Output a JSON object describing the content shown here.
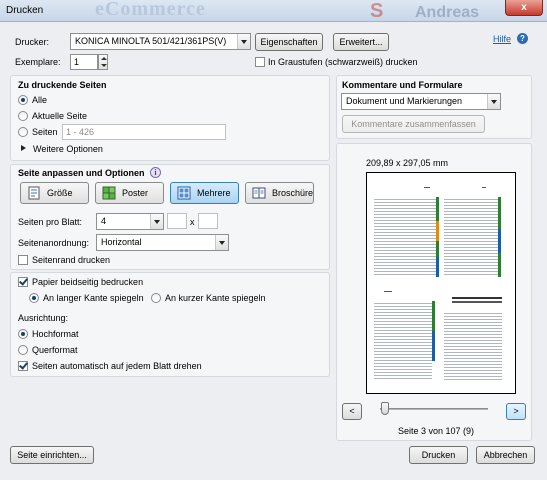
{
  "window": {
    "title": "Drucken",
    "close_label": "x",
    "background_text": [
      "eCommerce",
      "S",
      "Andreas"
    ]
  },
  "printer": {
    "label": "Drucker:",
    "value": "KONICA MINOLTA 501/421/361PS(V)",
    "properties_button": "Eigenschaften",
    "advanced_button": "Erweitert...",
    "help_link": "Hilfe",
    "copies_label": "Exemplare:",
    "copies_value": "1",
    "grayscale_label": "In Graustufen (schwarzweiß) drucken"
  },
  "pages": {
    "header": "Zu druckende Seiten",
    "all_label": "Alle",
    "current_label": "Aktuelle Seite",
    "pages_label": "Seiten",
    "pages_value": "1 - 426",
    "more_options": "Weitere Optionen"
  },
  "sizing": {
    "header": "Seite anpassen und Optionen",
    "modes": [
      "Größe",
      "Poster",
      "Mehrere",
      "Broschüre"
    ],
    "pages_per_sheet_label": "Seiten pro Blatt:",
    "pages_per_sheet_value": "4",
    "x_label": "x",
    "order_label": "Seitenanordnung:",
    "order_value": "Horizontal",
    "border_label": "Seitenrand drucken"
  },
  "duplex": {
    "both_sides_label": "Papier beidseitig bedrucken",
    "long_edge_label": "An langer Kante spiegeln",
    "short_edge_label": "An kurzer Kante spiegeln"
  },
  "orientation": {
    "header": "Ausrichtung:",
    "portrait_label": "Hochformat",
    "landscape_label": "Querformat",
    "auto_rotate_label": "Seiten automatisch auf jedem Blatt drehen"
  },
  "comments": {
    "header": "Kommentare und Formulare",
    "value": "Dokument und Markierungen",
    "summarize_button": "Kommentare zusammenfassen"
  },
  "preview": {
    "size_text": "209,89 x 297,05 mm",
    "page_status": "Seite 3 von 107 (9)",
    "prev_label": "<",
    "next_label": ">"
  },
  "footer": {
    "page_setup_button": "Seite einrichten...",
    "print_button": "Drucken",
    "cancel_button": "Abbrechen"
  },
  "colors": {
    "accent": "#1f5fa6",
    "active_mode": "#a9d4f3"
  }
}
